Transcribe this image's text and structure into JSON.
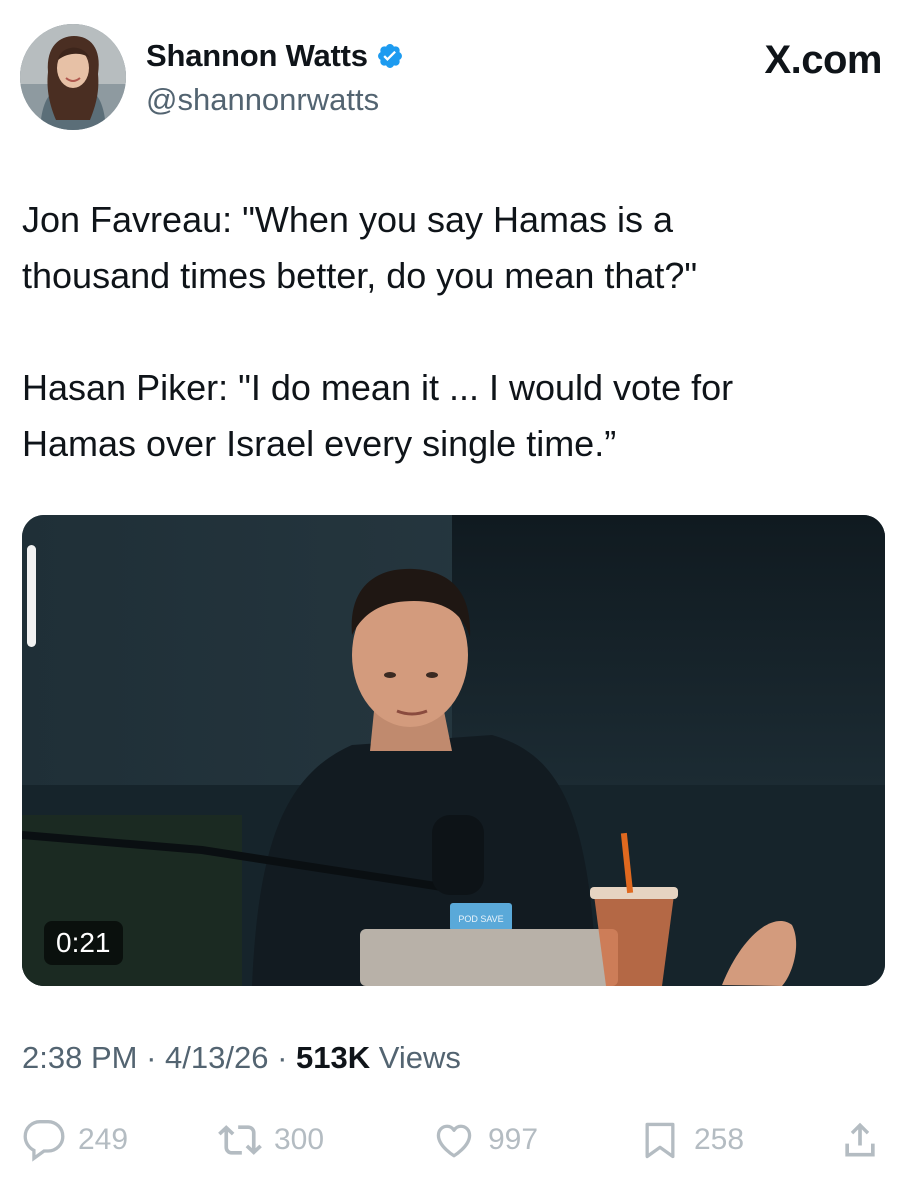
{
  "header": {
    "display_name": "Shannon Watts",
    "handle": "@shannonrwatts",
    "verified": true,
    "brand": "X.com"
  },
  "tweet": {
    "text_paragraph_1": "Jon Favreau: \"When you say Hamas is a\nthousand times better, do you mean that?\"",
    "text_paragraph_2": "Hasan Piker: \"I do mean it ... I would vote for\nHamas over Israel every single time.”"
  },
  "media": {
    "type": "video",
    "duration": "0:21",
    "mic_label": "POD SAVE"
  },
  "meta": {
    "time": "2:38 PM",
    "date": "4/13/26",
    "views_count": "513K",
    "views_label": "Views",
    "separator": "·"
  },
  "actions": {
    "replies": "249",
    "reposts": "300",
    "likes": "997",
    "bookmarks": "258"
  },
  "icons": {
    "verified": "verified-badge-icon",
    "reply": "reply-icon",
    "repost": "repost-icon",
    "like": "heart-icon",
    "bookmark": "bookmark-icon",
    "share": "share-icon"
  },
  "colors": {
    "verified_blue": "#1d9bf0",
    "secondary_text": "#536471",
    "action_gray": "#b4bcc2"
  }
}
